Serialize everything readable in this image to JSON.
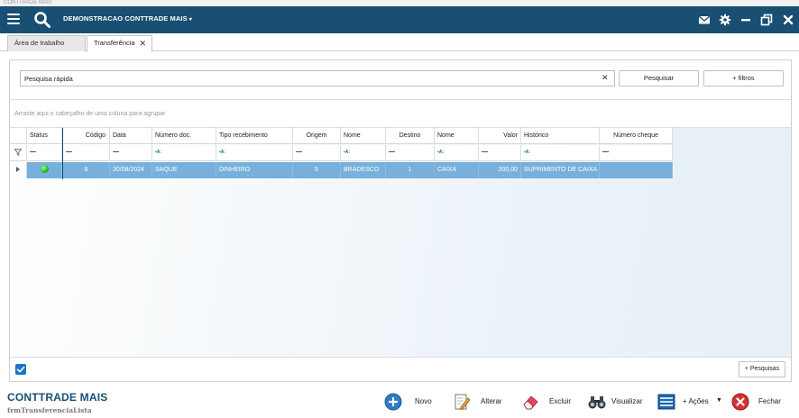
{
  "window": {
    "title": "CONTTRADE MAIS"
  },
  "topbar": {
    "app_name": "DEMONSTRACAO CONTTRADE MAIS",
    "caret": "▾"
  },
  "tabs": [
    {
      "label": "Área de trabalho"
    },
    {
      "label": "Transferência",
      "close": "✕"
    }
  ],
  "search": {
    "value": "Pesquisa rápida",
    "clear": "✕",
    "search_label": "Pesquisar",
    "filters_label": "+ filtros"
  },
  "grid": {
    "group_hint": "Arraste aqui o cabeçalho de uma coluna para agrupar",
    "columns": [
      "Status",
      "Código",
      "Data",
      "Número doc.",
      "Tipo recebimento",
      "Origem",
      "Nome",
      "Destino",
      "Nome",
      "Valor",
      "Histórico",
      "Número cheque"
    ],
    "filter_operators": [
      "=",
      "=",
      "=",
      "abc",
      "abc",
      "=",
      "abc",
      "=",
      "abc",
      "=",
      "abc",
      "="
    ],
    "rows": [
      {
        "status": "green",
        "codigo": "8",
        "data": "30/08/2024",
        "numero_doc": "SAQUE",
        "tipo_recebimento": "DINHEIRO",
        "origem": "5",
        "nome_origem": "BRADESCO",
        "destino": "1",
        "nome_destino": "CAIXA",
        "valor": "200,00",
        "historico": "SUPRIMENTO DE CAIXA",
        "numero_cheque": ""
      }
    ]
  },
  "footer": {
    "pesquisas_label": "+ Pesquisas"
  },
  "bottom": {
    "brand": "CONTTRADE MAIS",
    "form_name": "frmTransferenciaLista",
    "actions": {
      "novo": "Novo",
      "alterar": "Alterar",
      "excluir": "Excluir",
      "visualizar": "Visualizar",
      "acoes": "+ Ações",
      "fechar": "Fechar"
    }
  },
  "colors": {
    "topbar": "#184f72",
    "selected_row": "#77b0dc",
    "brand": "#184f72",
    "checkbox": "#1a73c7"
  }
}
